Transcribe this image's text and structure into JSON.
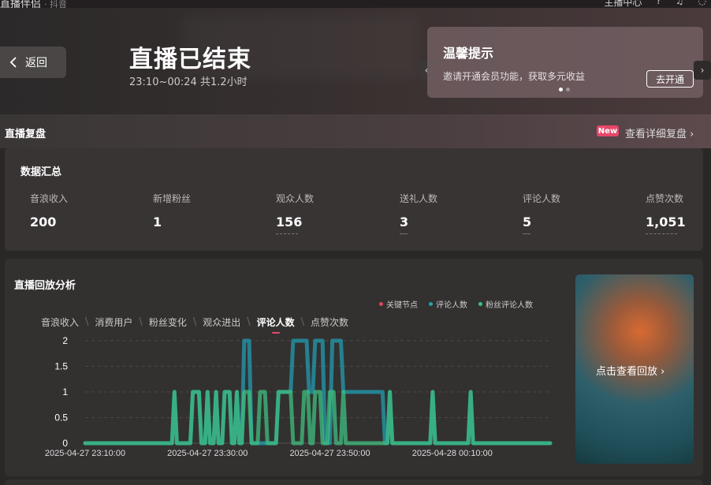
{
  "topbar": {
    "brand": "直播伴侣",
    "sub": "· 抖音",
    "right_label": "主播中心"
  },
  "hero": {
    "back_label": "返回",
    "title": "直播已结束",
    "time_range": "23:10~00:24 共1.2小时"
  },
  "tip": {
    "title": "温馨提示",
    "desc": "邀请开通会员功能，获取多元收益",
    "button": "去开通"
  },
  "review": {
    "title": "直播复盘",
    "badge": "New",
    "detail_link": "查看详细复盘"
  },
  "summary": {
    "title": "数据汇总",
    "metrics": [
      {
        "label": "音浪收入",
        "value": "200"
      },
      {
        "label": "新增粉丝",
        "value": "1"
      },
      {
        "label": "观众人数",
        "value": "156"
      },
      {
        "label": "送礼人数",
        "value": "3"
      },
      {
        "label": "评论人数",
        "value": "5"
      },
      {
        "label": "点赞次数",
        "value": "1,051"
      }
    ]
  },
  "analysis": {
    "title": "直播回放分析",
    "tabs": [
      "音浪收入",
      "消费用户",
      "粉丝变化",
      "观众进出",
      "评论人数",
      "点赞次数"
    ],
    "active_tab": "评论人数",
    "replay_label": "点击查看回放"
  },
  "colors": {
    "key_node": "#e0465e",
    "comment": "#1fa3b8",
    "fan_comment": "#3fbf7f",
    "accent": "#e8466a"
  },
  "chart_data": {
    "type": "line",
    "legend": [
      "关键节点",
      "评论人数",
      "粉丝评论人数"
    ],
    "x_tick_labels": [
      "2025-04-27 23:10:00",
      "2025-04-27 23:30:00",
      "2025-04-27 23:50:00",
      "2025-04-28 00:10:00"
    ],
    "y_ticks": [
      "0",
      "0.5",
      "1",
      "1.5",
      "2"
    ],
    "ylim": [
      0,
      2
    ],
    "x_range_minutes": [
      0,
      76
    ],
    "grid": true,
    "legend_placement": "top-right",
    "series": [
      {
        "name": "评论人数",
        "points": [
          [
            0,
            0
          ],
          [
            14.2,
            0
          ],
          [
            14.6,
            1
          ],
          [
            15.0,
            0
          ],
          [
            17.2,
            0
          ],
          [
            17.6,
            1
          ],
          [
            18.6,
            1
          ],
          [
            19.0,
            0
          ],
          [
            19.6,
            0
          ],
          [
            20.0,
            1
          ],
          [
            20.4,
            0
          ],
          [
            21.0,
            0
          ],
          [
            21.4,
            1
          ],
          [
            21.8,
            0
          ],
          [
            22.4,
            0
          ],
          [
            22.8,
            1
          ],
          [
            23.6,
            1
          ],
          [
            24.0,
            0
          ],
          [
            24.4,
            0
          ],
          [
            24.8,
            1
          ],
          [
            25.2,
            0
          ],
          [
            25.6,
            0
          ],
          [
            26.0,
            2
          ],
          [
            26.8,
            2
          ],
          [
            27.2,
            0
          ],
          [
            31.2,
            0
          ],
          [
            31.6,
            1
          ],
          [
            33.6,
            1
          ],
          [
            34.0,
            2
          ],
          [
            36.2,
            2
          ],
          [
            36.6,
            1
          ],
          [
            37.2,
            1
          ],
          [
            37.6,
            2
          ],
          [
            38.8,
            2
          ],
          [
            39.2,
            0
          ],
          [
            40.0,
            0
          ],
          [
            40.4,
            2
          ],
          [
            41.8,
            2
          ],
          [
            42.2,
            1
          ],
          [
            48.6,
            1
          ],
          [
            49.0,
            0
          ],
          [
            49.4,
            0
          ],
          [
            49.8,
            1
          ],
          [
            50.2,
            0
          ],
          [
            56.4,
            0
          ],
          [
            56.8,
            1
          ],
          [
            57.2,
            0
          ],
          [
            62.6,
            0
          ],
          [
            63.0,
            1
          ],
          [
            63.4,
            0
          ],
          [
            76,
            0
          ]
        ]
      },
      {
        "name": "粉丝评论人数",
        "points": [
          [
            0,
            0
          ],
          [
            14.2,
            0
          ],
          [
            14.6,
            1
          ],
          [
            15.0,
            0
          ],
          [
            17.2,
            0
          ],
          [
            17.6,
            1
          ],
          [
            18.6,
            1
          ],
          [
            19.0,
            0
          ],
          [
            19.6,
            0
          ],
          [
            20.0,
            1
          ],
          [
            20.4,
            0
          ],
          [
            21.0,
            0
          ],
          [
            21.4,
            1
          ],
          [
            21.8,
            0
          ],
          [
            22.4,
            0
          ],
          [
            22.8,
            1
          ],
          [
            23.6,
            1
          ],
          [
            24.0,
            0
          ],
          [
            24.4,
            0
          ],
          [
            24.8,
            1
          ],
          [
            25.2,
            0
          ],
          [
            25.6,
            0
          ],
          [
            26.0,
            1
          ],
          [
            26.8,
            1
          ],
          [
            27.2,
            0
          ],
          [
            28.2,
            0
          ],
          [
            28.6,
            1
          ],
          [
            29.4,
            1
          ],
          [
            29.8,
            0
          ],
          [
            31.2,
            0
          ],
          [
            31.6,
            1
          ],
          [
            33.6,
            1
          ],
          [
            34.0,
            0
          ],
          [
            35.4,
            0
          ],
          [
            35.8,
            1
          ],
          [
            36.4,
            1
          ],
          [
            36.8,
            0
          ],
          [
            37.2,
            0
          ],
          [
            37.6,
            1
          ],
          [
            38.4,
            1
          ],
          [
            38.8,
            0
          ],
          [
            39.6,
            0
          ],
          [
            40.0,
            1
          ],
          [
            40.6,
            1
          ],
          [
            41.0,
            0
          ],
          [
            41.8,
            0
          ],
          [
            42.2,
            1
          ],
          [
            42.6,
            0
          ],
          [
            49.4,
            0
          ],
          [
            49.8,
            1
          ],
          [
            50.2,
            0
          ],
          [
            56.4,
            0
          ],
          [
            56.8,
            1
          ],
          [
            57.2,
            0
          ],
          [
            62.6,
            0
          ],
          [
            63.0,
            1
          ],
          [
            63.4,
            0
          ],
          [
            76,
            0
          ]
        ]
      }
    ]
  }
}
